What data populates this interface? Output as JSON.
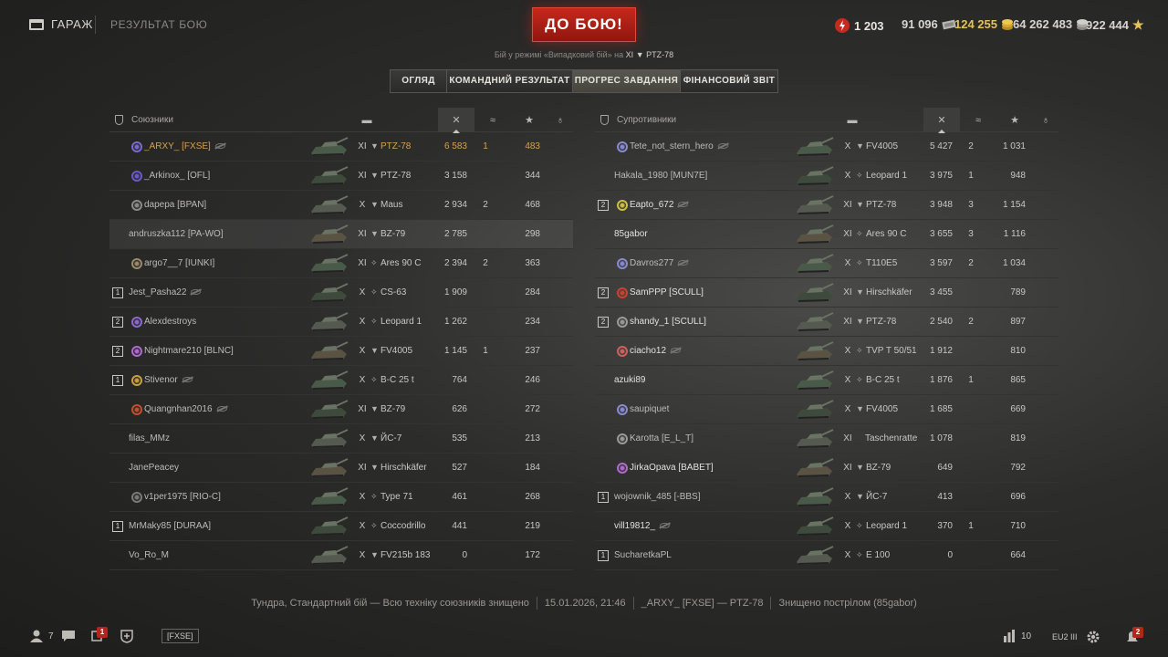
{
  "header": {
    "garage_label": "ГАРАЖ",
    "breadcrumb": "РЕЗУЛЬТАТ БОЮ",
    "battle_button": "ДО БОЮ!",
    "mode_prefix": "Бій у режимі «Випадковий бій» на",
    "mode_tier": "XI",
    "mode_tank": "PTZ-78",
    "currencies": [
      {
        "name": "bonds",
        "value": "1 203",
        "icon": "bond-icon",
        "color": "#e8e6e0"
      },
      {
        "name": "credits",
        "value": "91 096",
        "icon": "credits-icon",
        "color": "#d6d4ce"
      },
      {
        "name": "gold",
        "value": "124 255",
        "icon": "gold-icon",
        "color": "#e6c15a"
      },
      {
        "name": "silver",
        "value": "64 262 483",
        "icon": "silver-icon",
        "color": "#d6d4ce"
      },
      {
        "name": "free_xp",
        "value": "922 444",
        "icon": "star-icon",
        "color": "#d6d4ce"
      }
    ]
  },
  "tabs": [
    {
      "label": "ОГЛЯД",
      "active": true
    },
    {
      "label": "КОМАНДНИЙ РЕЗУЛЬТАТ",
      "active": false
    },
    {
      "label": "ПРОГРЕС ЗАВДАННЯ",
      "active": true
    },
    {
      "label": "ФІНАНСОВИЙ ЗВІТ",
      "active": false
    }
  ],
  "allies": {
    "title": "Союзники",
    "rows": [
      {
        "platoon": "",
        "badge": "#7a6ad0",
        "name": "_ARXY_ [FXSE]",
        "hidden": true,
        "me": true,
        "tier": "XI",
        "type": "▼",
        "tank": "PTZ-78",
        "dmg": "6 583",
        "kills": "1",
        "xp": "483"
      },
      {
        "platoon": "",
        "badge": "#6a5ac8",
        "name": "_Arkinox_ [OFL]",
        "hidden": false,
        "tier": "XI",
        "type": "▼",
        "tank": "PTZ-78",
        "dmg": "3 158",
        "kills": "",
        "xp": "344"
      },
      {
        "platoon": "",
        "badge": "#8a8a88",
        "name": "dapepa [BPAN]",
        "hidden": false,
        "tier": "X",
        "type": "▼",
        "tank": "Maus",
        "dmg": "2 934",
        "kills": "2",
        "xp": "468"
      },
      {
        "platoon": "",
        "badge": "",
        "name": "andruszka112 [PA-WO]",
        "hidden": false,
        "highlight": true,
        "tier": "XI",
        "type": "▼",
        "tank": "BZ-79",
        "dmg": "2 785",
        "kills": "",
        "xp": "298"
      },
      {
        "platoon": "",
        "badge": "#9a8a6a",
        "name": "argo7__7 [IUNKI]",
        "hidden": false,
        "tier": "XI",
        "type": "✧",
        "tank": "Ares 90 C",
        "dmg": "2 394",
        "kills": "2",
        "xp": "363"
      },
      {
        "platoon": "1",
        "badge": "",
        "name": "Jest_Pasha22",
        "hidden": true,
        "tier": "X",
        "type": "✧",
        "tank": "CS-63",
        "dmg": "1 909",
        "kills": "",
        "xp": "284"
      },
      {
        "platoon": "2",
        "badge": "#8a6ad0",
        "name": "Alexdestroys",
        "hidden": false,
        "tier": "X",
        "type": "✧",
        "tank": "Leopard 1",
        "dmg": "1 262",
        "kills": "",
        "xp": "234"
      },
      {
        "platoon": "2",
        "badge": "#b06ad0",
        "name": "Nightmare210 [BLNC]",
        "hidden": false,
        "tier": "X",
        "type": "▼",
        "tank": "FV4005",
        "dmg": "1 145",
        "kills": "1",
        "xp": "237"
      },
      {
        "platoon": "1",
        "badge": "#c8a040",
        "name": "Stivenor",
        "hidden": true,
        "tier": "X",
        "type": "✧",
        "tank": "B-C 25 t",
        "dmg": "764",
        "kills": "",
        "xp": "246"
      },
      {
        "platoon": "",
        "badge": "#c05030",
        "name": "Quangnhan2016",
        "hidden": true,
        "tier": "XI",
        "type": "▼",
        "tank": "BZ-79",
        "dmg": "626",
        "kills": "",
        "xp": "272"
      },
      {
        "platoon": "",
        "badge": "",
        "name": "filas_MMz",
        "hidden": false,
        "tier": "X",
        "type": "▼",
        "tank": "ЙС-7",
        "dmg": "535",
        "kills": "",
        "xp": "213"
      },
      {
        "platoon": "",
        "badge": "",
        "name": "JanePeacey",
        "hidden": false,
        "tier": "XI",
        "type": "▼",
        "tank": "Hirschkäfer",
        "dmg": "527",
        "kills": "",
        "xp": "184"
      },
      {
        "platoon": "",
        "badge": "#7a7a78",
        "name": "v1per1975 [RIO-C]",
        "hidden": false,
        "tier": "X",
        "type": "✧",
        "tank": "Type 71",
        "dmg": "461",
        "kills": "",
        "xp": "268"
      },
      {
        "platoon": "1",
        "badge": "",
        "name": "MrMaky85 [DURAA]",
        "hidden": false,
        "tier": "X",
        "type": "✧",
        "tank": "Coccodrillo",
        "dmg": "441",
        "kills": "",
        "xp": "219"
      },
      {
        "platoon": "",
        "badge": "",
        "name": "Vo_Ro_M",
        "hidden": false,
        "tier": "X",
        "type": "▼",
        "tank": "FV215b 183",
        "dmg": "0",
        "kills": "",
        "xp": "172"
      }
    ]
  },
  "enemies": {
    "title": "Супротивники",
    "rows": [
      {
        "platoon": "",
        "badge": "#8a8ad0",
        "name": "Tete_not_stern_hero",
        "hidden": true,
        "tier": "X",
        "type": "▼",
        "tank": "FV4005",
        "dmg": "5 427",
        "kills": "2",
        "xp": "1 031"
      },
      {
        "platoon": "",
        "badge": "",
        "name": "Hakala_1980 [MUN7E]",
        "hidden": false,
        "tier": "X",
        "type": "✧",
        "tank": "Leopard 1",
        "dmg": "3 975",
        "kills": "1",
        "xp": "948"
      },
      {
        "platoon": "2",
        "badge": "#d0c040",
        "name": "Eapto_672",
        "hidden": true,
        "bright": true,
        "tier": "XI",
        "type": "▼",
        "tank": "PTZ-78",
        "dmg": "3 948",
        "kills": "3",
        "xp": "1 154"
      },
      {
        "platoon": "",
        "badge": "",
        "name": "85gabor",
        "hidden": false,
        "bright": true,
        "tier": "XI",
        "type": "✧",
        "tank": "Ares 90 C",
        "dmg": "3 655",
        "kills": "3",
        "xp": "1 116"
      },
      {
        "platoon": "",
        "badge": "#8a8ad0",
        "name": "Davros277",
        "hidden": true,
        "tier": "X",
        "type": "✧",
        "tank": "T110E5",
        "dmg": "3 597",
        "kills": "2",
        "xp": "1 034"
      },
      {
        "platoon": "2",
        "badge": "#d04030",
        "name": "SamPPP [SCULL]",
        "hidden": false,
        "bright": true,
        "tier": "XI",
        "type": "▼",
        "tank": "Hirschkäfer",
        "dmg": "3 455",
        "kills": "",
        "xp": "789"
      },
      {
        "platoon": "2",
        "badge": "#9a9a98",
        "name": "shandy_1 [SCULL]",
        "hidden": false,
        "bright": true,
        "tier": "XI",
        "type": "▼",
        "tank": "PTZ-78",
        "dmg": "2 540",
        "kills": "2",
        "xp": "897"
      },
      {
        "platoon": "",
        "badge": "#d06060",
        "name": "ciacho12",
        "hidden": true,
        "bright": true,
        "tier": "X",
        "type": "✧",
        "tank": "TVP T 50/51",
        "dmg": "1 912",
        "kills": "",
        "xp": "810"
      },
      {
        "platoon": "",
        "badge": "",
        "name": "azuki89",
        "hidden": false,
        "bright": true,
        "tier": "X",
        "type": "✧",
        "tank": "B-C 25 t",
        "dmg": "1 876",
        "kills": "1",
        "xp": "865"
      },
      {
        "platoon": "",
        "badge": "#8a8ad0",
        "name": "saupiquet",
        "hidden": false,
        "tier": "X",
        "type": "▼",
        "tank": "FV4005",
        "dmg": "1 685",
        "kills": "",
        "xp": "669"
      },
      {
        "platoon": "",
        "badge": "#9a9a98",
        "name": "Karotta [E_L_T]",
        "hidden": false,
        "tier": "XI",
        "type": "",
        "tank": "Taschenratte",
        "dmg": "1 078",
        "kills": "",
        "xp": "819"
      },
      {
        "platoon": "",
        "badge": "#b06ad0",
        "name": "JirkaOpava [BABET]",
        "hidden": false,
        "bright": true,
        "tier": "XI",
        "type": "▼",
        "tank": "BZ-79",
        "dmg": "649",
        "kills": "",
        "xp": "792"
      },
      {
        "platoon": "1",
        "badge": "",
        "name": "wojownik_485 [-BBS]",
        "hidden": false,
        "tier": "X",
        "type": "▼",
        "tank": "ЙС-7",
        "dmg": "413",
        "kills": "",
        "xp": "696"
      },
      {
        "platoon": "",
        "badge": "",
        "name": "vill19812_",
        "hidden": true,
        "bright": true,
        "tier": "X",
        "type": "✧",
        "tank": "Leopard 1",
        "dmg": "370",
        "kills": "1",
        "xp": "710"
      },
      {
        "platoon": "1",
        "badge": "",
        "name": "SucharetkaPL",
        "hidden": false,
        "tier": "X",
        "type": "✧",
        "tank": "E 100",
        "dmg": "0",
        "kills": "",
        "xp": "664"
      }
    ]
  },
  "status": {
    "map": "Тундра, Стандартний бій — Всю техніку союзників знищено",
    "datetime": "15.01.2026, 21:46",
    "player": "_ARXY_ [FXSE] — PTZ-78",
    "killed_by": "Знищено пострілом (85gabor)"
  },
  "bottom": {
    "friends_count": "7",
    "chat_badge": "1",
    "clan_tag": "[FXSE]",
    "sessions": "10",
    "server": "EU2",
    "server_load": "III",
    "notif_badge": "2"
  }
}
